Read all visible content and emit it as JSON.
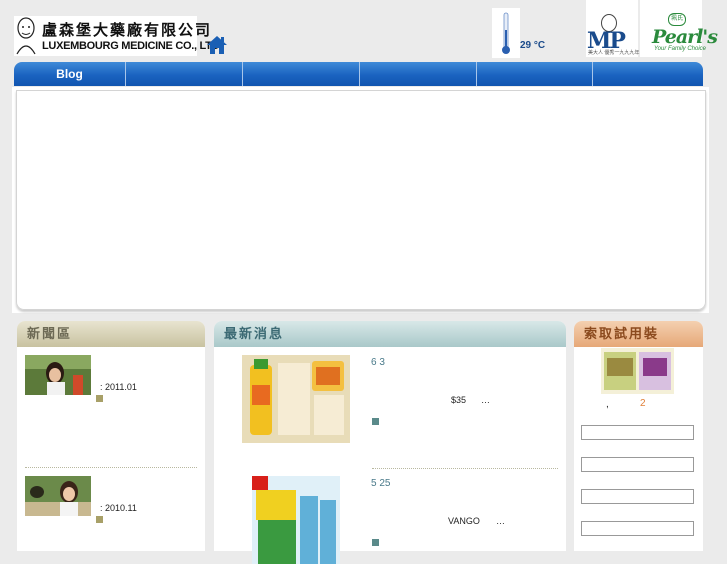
{
  "header": {
    "company_cn": "盧森堡大藥廠有限公司",
    "company_en": "LUXEMBOURG MEDICINE CO., LTD.",
    "temperature": "29 °C",
    "brands": {
      "mp": {
        "logo_text": "MP",
        "tagline": "美大人 優秀一九九九年"
      },
      "pearls": {
        "logo_text": "Pearl's",
        "tagline": "Your Family Choice",
        "badge": "珮氏"
      }
    }
  },
  "nav": {
    "items": [
      "Blog",
      "",
      "",
      "",
      "",
      ""
    ]
  },
  "columns": {
    "news": {
      "title": "新聞區",
      "items": [
        {
          "date": ": 2011.01"
        },
        {
          "date": ": 2010.11"
        }
      ]
    },
    "latest": {
      "title": "最新消息",
      "items": [
        {
          "date": "6 3",
          "text": "$35",
          "ellipsis": "…"
        },
        {
          "date": "5 25",
          "text": "VANGO",
          "ellipsis": "…"
        }
      ]
    },
    "samples": {
      "title": "索取試用裝",
      "text": ",",
      "number": "2",
      "fields": [
        "",
        "",
        "",
        ""
      ]
    }
  },
  "colors": {
    "nav_blue": "#1a63c0",
    "news_header": "#c8c2a0",
    "latest_header": "#a9c8c9",
    "samples_header": "#e6a878",
    "background": "#ebebeb"
  }
}
